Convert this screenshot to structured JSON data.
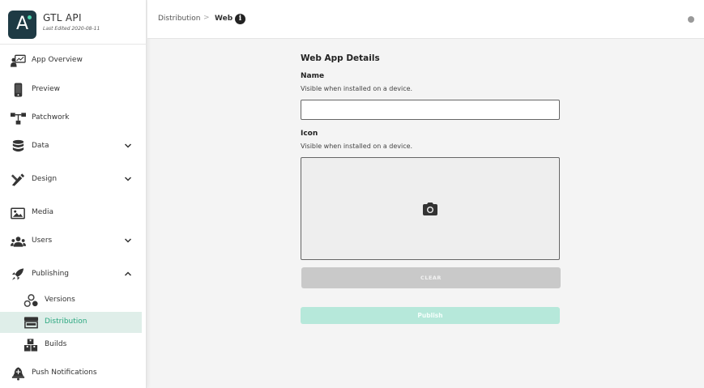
{
  "app": {
    "name": "GTL API",
    "last_edited": "Last Edited 2020-08-11",
    "logo_letter": "A"
  },
  "sidebar": {
    "items": [
      {
        "label": "App Overview",
        "icon": "app-overview-icon"
      },
      {
        "label": "Preview",
        "icon": "phone-icon"
      },
      {
        "label": "Patchwork",
        "icon": "patchwork-icon"
      },
      {
        "label": "Data",
        "icon": "database-icon",
        "chevron": "down"
      },
      {
        "label": "Design",
        "icon": "design-icon",
        "chevron": "down"
      },
      {
        "label": "Media",
        "icon": "media-icon"
      },
      {
        "label": "Users",
        "icon": "users-icon",
        "chevron": "down"
      },
      {
        "label": "Publishing",
        "icon": "rocket-icon",
        "chevron": "up"
      },
      {
        "label": "Versions",
        "icon": "versions-icon",
        "sub": true
      },
      {
        "label": "Distribution",
        "icon": "storefront-icon",
        "sub": true,
        "active": true
      },
      {
        "label": "Builds",
        "icon": "builds-icon",
        "sub": true
      },
      {
        "label": "Push Notifications",
        "icon": "bell-icon"
      }
    ]
  },
  "breadcrumb": {
    "parent": "Distribution",
    "separator": ">",
    "current": "Web",
    "info_glyph": "i"
  },
  "form": {
    "title": "Web App Details",
    "name_label": "Name",
    "name_help": "Visible when installed on a device.",
    "name_value": "",
    "icon_label": "Icon",
    "icon_help": "Visible when installed on a device.",
    "clear_label": "CLEAR",
    "publish_label": "Publish"
  },
  "colors": {
    "accent": "#2aa77f",
    "active_bg": "#dfeee9",
    "logo_bg": "#1e3a44",
    "publish_bg": "#b6e8da",
    "clear_bg": "#c9c9c9"
  }
}
